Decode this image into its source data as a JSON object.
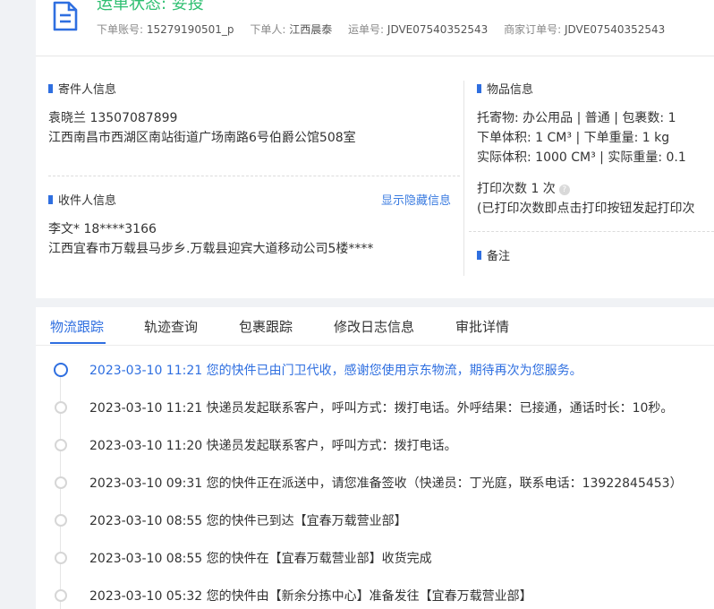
{
  "header": {
    "status": "运单状态: 妥投",
    "meta": [
      {
        "key": "下单账号:",
        "value": "15279190501_p"
      },
      {
        "key": "下单人:",
        "value": "江西晨泰"
      },
      {
        "key": "运单号:",
        "value": "JDVE07540352543"
      },
      {
        "key": "商家订单号:",
        "value": "JDVE07540352543"
      }
    ]
  },
  "sender": {
    "title": "寄件人信息",
    "name_phone": "袁晓兰   13507087899",
    "address": "江西南昌市西湖区南站街道广场南路6号伯爵公馆508室"
  },
  "receiver": {
    "title": "收件人信息",
    "show_hidden": "显示隐藏信息",
    "name_phone": "李文*   18****3166",
    "address": "江西宜春市万载县马步乡.万载县迎宾大道移动公司5楼****"
  },
  "goods": {
    "title": "物品信息",
    "line1": "托寄物:  办公用品 | 普通  |  包裹数:  1",
    "line2": "下单体积:   1 CM³  |  下单重量:   1 kg",
    "line3": "实际体积:   1000 CM³  |  实际重量:   0.1",
    "print_label": "打印次数   1 次",
    "print_note": "(已打印次数即点击打印按钮发起打印次"
  },
  "remark": {
    "title": "备注"
  },
  "tabs": [
    "物流跟踪",
    "轨迹查询",
    "包裹跟踪",
    "修改日志信息",
    "审批详情"
  ],
  "timeline": [
    "2023-03-10 11:21 您的快件已由门卫代收，感谢您使用京东物流，期待再次为您服务。",
    "2023-03-10 11:21 快递员发起联系客户，呼叫方式：拨打电话。外呼结果：已接通，通话时长：10秒。",
    "2023-03-10 11:20 快递员发起联系客户，呼叫方式：拨打电话。",
    "2023-03-10 09:31 您的快件正在派送中，请您准备签收（快递员：丁光庭，联系电话：13922845453）",
    "2023-03-10 08:55 您的快件已到达【宜春万载营业部】",
    "2023-03-10 08:55 您的快件在【宜春万载营业部】收货完成",
    "2023-03-10 05:32 您的快件由【新余分拣中心】准备发往【宜春万载营业部】"
  ],
  "colors": {
    "accent": "#2f6fe0",
    "status_green": "#2fbf71"
  }
}
